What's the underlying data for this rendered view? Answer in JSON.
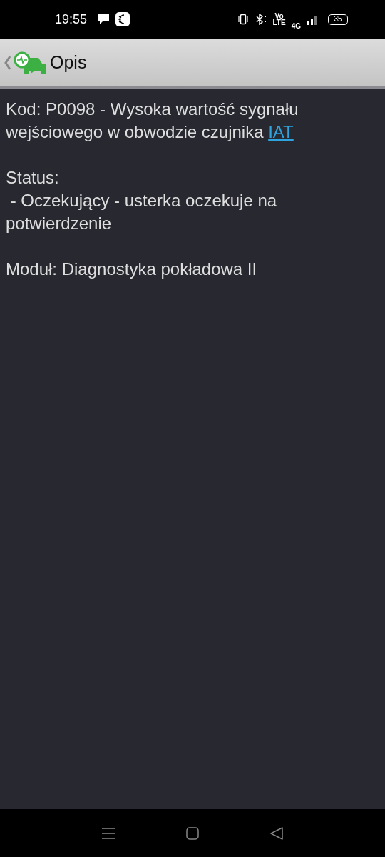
{
  "status_bar": {
    "time": "19:55",
    "volte_top": "Vo",
    "volte_bottom": "LTE",
    "network": "4G",
    "battery": "35"
  },
  "toolbar": {
    "title": "Opis"
  },
  "description": {
    "code_text": "Kod: P0098 - Wysoka wartość sygnału wejściowego w obwodzie czujnika",
    "code_link": "IAT",
    "status_label": "Status:",
    "status_value": " - Oczekujący - usterka oczekuje na potwierdzenie",
    "module": "Moduł: Diagnostyka pokładowa II"
  }
}
